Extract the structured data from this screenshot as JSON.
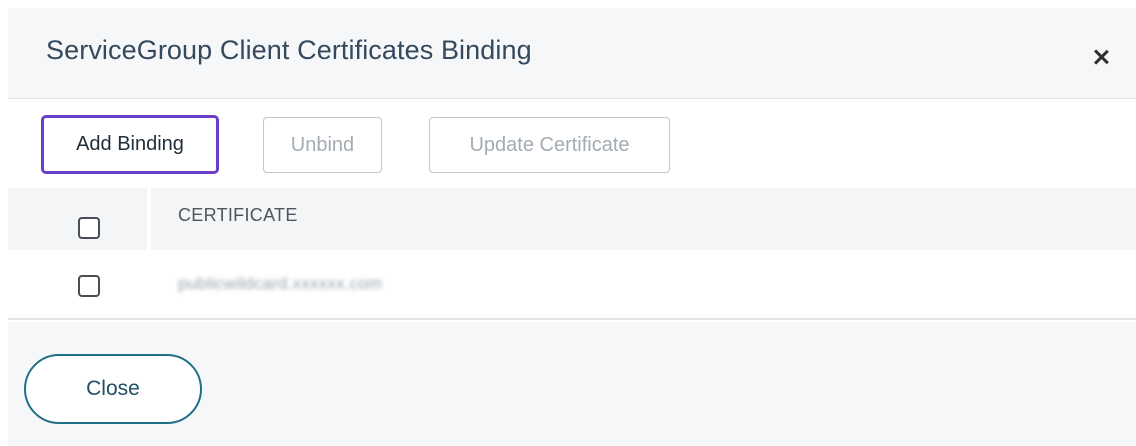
{
  "dialog": {
    "title": "ServiceGroup Client Certificates Binding"
  },
  "toolbar": {
    "add_binding_label": "Add Binding",
    "unbind_label": "Unbind",
    "update_certificate_label": "Update Certificate"
  },
  "table": {
    "columns": [
      "CERTIFICATE"
    ],
    "rows": [
      {
        "certificate": "publicwildcard.xxxxxx.com",
        "checked": false
      }
    ]
  },
  "footer": {
    "close_label": "Close"
  },
  "colors": {
    "focus_outline": "#6b3fc6",
    "close_button_border": "#1f6f86",
    "title_text": "#34495e"
  },
  "icons": [
    "close-icon",
    "checkbox-icon"
  ]
}
